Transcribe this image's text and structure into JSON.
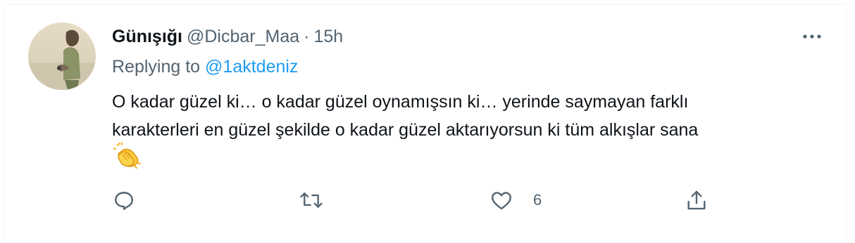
{
  "tweet": {
    "display_name": "Günışığı",
    "handle": "@Dicbar_Maa",
    "separator": "·",
    "time": "15h",
    "replying_prefix": "Replying to ",
    "replying_to": "@1aktdeniz",
    "text_line1": "O kadar güzel ki… o kadar güzel oynamışsın ki… yerinde saymayan farklı",
    "text_line2": "karakterleri en güzel şekilde o kadar güzel aktarıyorsun ki tüm alkışlar sana",
    "emoji": "clapping-hands"
  },
  "actions": {
    "reply_icon": "reply-icon",
    "retweet_icon": "retweet-icon",
    "like_icon": "heart-icon",
    "like_count": "6",
    "share_icon": "share-icon"
  },
  "colors": {
    "text": "#0f1419",
    "secondary": "#536471",
    "link": "#1d9bf0",
    "border": "#eff3f4"
  }
}
